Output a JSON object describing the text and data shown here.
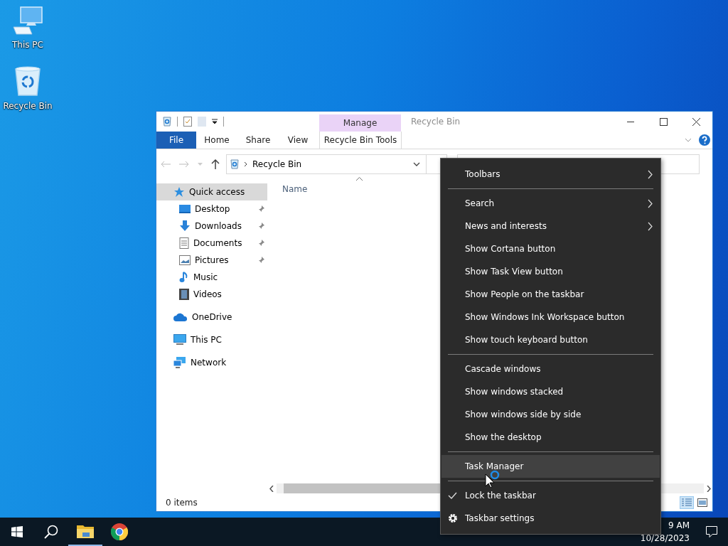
{
  "desktop_icons": [
    {
      "label": "This PC",
      "kind": "pc"
    },
    {
      "label": "Recycle Bin",
      "kind": "bin"
    }
  ],
  "explorer": {
    "title": "Recycle Bin",
    "context_tab": "Manage",
    "ribbon_tabs": [
      {
        "label": "File",
        "kind": "file",
        "selected": false
      },
      {
        "label": "Home",
        "kind": "tab",
        "selected": false
      },
      {
        "label": "Share",
        "kind": "tab",
        "selected": false
      },
      {
        "label": "View",
        "kind": "tab",
        "selected": false
      },
      {
        "label": "Recycle Bin Tools",
        "kind": "context",
        "selected": false
      }
    ],
    "address": "Recycle Bin",
    "column_header": "Name",
    "nav": [
      {
        "label": "Quick access",
        "kind": "star",
        "selected": true,
        "children": [
          {
            "label": "Desktop",
            "kind": "desktop",
            "selected": false,
            "pinned": true
          },
          {
            "label": "Downloads",
            "kind": "download",
            "selected": false,
            "pinned": true
          },
          {
            "label": "Documents",
            "kind": "documents",
            "selected": false,
            "pinned": true
          },
          {
            "label": "Pictures",
            "kind": "pictures",
            "selected": false,
            "pinned": true
          },
          {
            "label": "Music",
            "kind": "music",
            "selected": false,
            "pinned": false
          },
          {
            "label": "Videos",
            "kind": "videos",
            "selected": false,
            "pinned": false
          }
        ]
      },
      {
        "label": "OneDrive",
        "kind": "cloud",
        "selected": false
      },
      {
        "label": "This PC",
        "kind": "pc",
        "selected": false
      },
      {
        "label": "Network",
        "kind": "network",
        "selected": false
      }
    ],
    "status": "0 items",
    "view_buttons": [
      {
        "kind": "details",
        "selected": true
      },
      {
        "kind": "tiles",
        "selected": false
      }
    ]
  },
  "context_menu": {
    "items": [
      {
        "kind": "item",
        "label": "Toolbars",
        "submenu": true,
        "checked": false,
        "highlighted": false
      },
      {
        "kind": "separator"
      },
      {
        "kind": "item",
        "label": "Search",
        "submenu": true,
        "checked": false,
        "highlighted": false
      },
      {
        "kind": "item",
        "label": "News and interests",
        "submenu": true,
        "checked": false,
        "highlighted": false
      },
      {
        "kind": "item",
        "label": "Show Cortana button",
        "submenu": false,
        "checked": false,
        "highlighted": false
      },
      {
        "kind": "item",
        "label": "Show Task View button",
        "submenu": false,
        "checked": false,
        "highlighted": false
      },
      {
        "kind": "item",
        "label": "Show People on the taskbar",
        "submenu": false,
        "checked": false,
        "highlighted": false
      },
      {
        "kind": "item",
        "label": "Show Windows Ink Workspace button",
        "submenu": false,
        "checked": false,
        "highlighted": false
      },
      {
        "kind": "item",
        "label": "Show touch keyboard button",
        "submenu": false,
        "checked": false,
        "highlighted": false
      },
      {
        "kind": "separator"
      },
      {
        "kind": "item",
        "label": "Cascade windows",
        "submenu": false,
        "checked": false,
        "highlighted": false
      },
      {
        "kind": "item",
        "label": "Show windows stacked",
        "submenu": false,
        "checked": false,
        "highlighted": false
      },
      {
        "kind": "item",
        "label": "Show windows side by side",
        "submenu": false,
        "checked": false,
        "highlighted": false
      },
      {
        "kind": "item",
        "label": "Show the desktop",
        "submenu": false,
        "checked": false,
        "highlighted": false
      },
      {
        "kind": "separator"
      },
      {
        "kind": "item",
        "label": "Task Manager",
        "submenu": false,
        "checked": false,
        "highlighted": true
      },
      {
        "kind": "separator"
      },
      {
        "kind": "item",
        "label": "Lock the taskbar",
        "submenu": false,
        "checked": true,
        "highlighted": false
      },
      {
        "kind": "settings",
        "label": "Taskbar settings",
        "submenu": false,
        "checked": false,
        "highlighted": false
      }
    ]
  },
  "taskbar": {
    "buttons": [
      {
        "kind": "start",
        "active": false
      },
      {
        "kind": "search",
        "active": false
      },
      {
        "kind": "explorer",
        "active": true
      },
      {
        "kind": "chrome",
        "active": false
      }
    ],
    "time": "9 AM",
    "date": "10/28/2023"
  }
}
